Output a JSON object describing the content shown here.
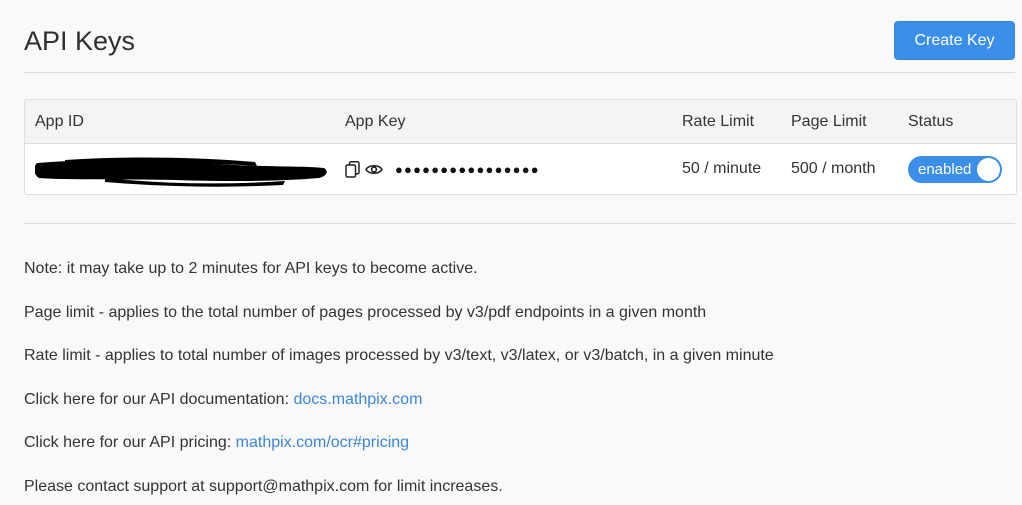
{
  "header": {
    "title": "API Keys",
    "create_button_label": "Create Key"
  },
  "table": {
    "columns": {
      "app_id": "App ID",
      "app_key": "App Key",
      "rate_limit": "Rate Limit",
      "page_limit": "Page Limit",
      "status": "Status"
    },
    "rows": [
      {
        "app_id_redacted": true,
        "app_key_masked": "●●●●●●●●●●●●●●●●",
        "rate_limit": "50 / minute",
        "page_limit": "500 / month",
        "status": "enabled"
      }
    ]
  },
  "notes": {
    "note1": "Note: it may take up to 2 minutes for API keys to become active.",
    "note2": "Page limit - applies to the total number of pages processed by v3/pdf endpoints in a given month",
    "note3": "Rate limit - applies to total number of images processed by v3/text, v3/latex, or v3/batch, in a given minute",
    "docs_prefix": "Click here for our API documentation: ",
    "docs_link": "docs.mathpix.com",
    "pricing_prefix": "Click here for our API pricing: ",
    "pricing_link": "mathpix.com/ocr#pricing",
    "contact": "Please contact support at support@mathpix.com for limit increases."
  },
  "colors": {
    "accent": "#3b8fe8",
    "link": "#3a86d4",
    "redaction": "#000000",
    "redaction_edge": "#f5c518"
  },
  "icons": {
    "copy": "copy-icon",
    "view": "eye-icon"
  }
}
